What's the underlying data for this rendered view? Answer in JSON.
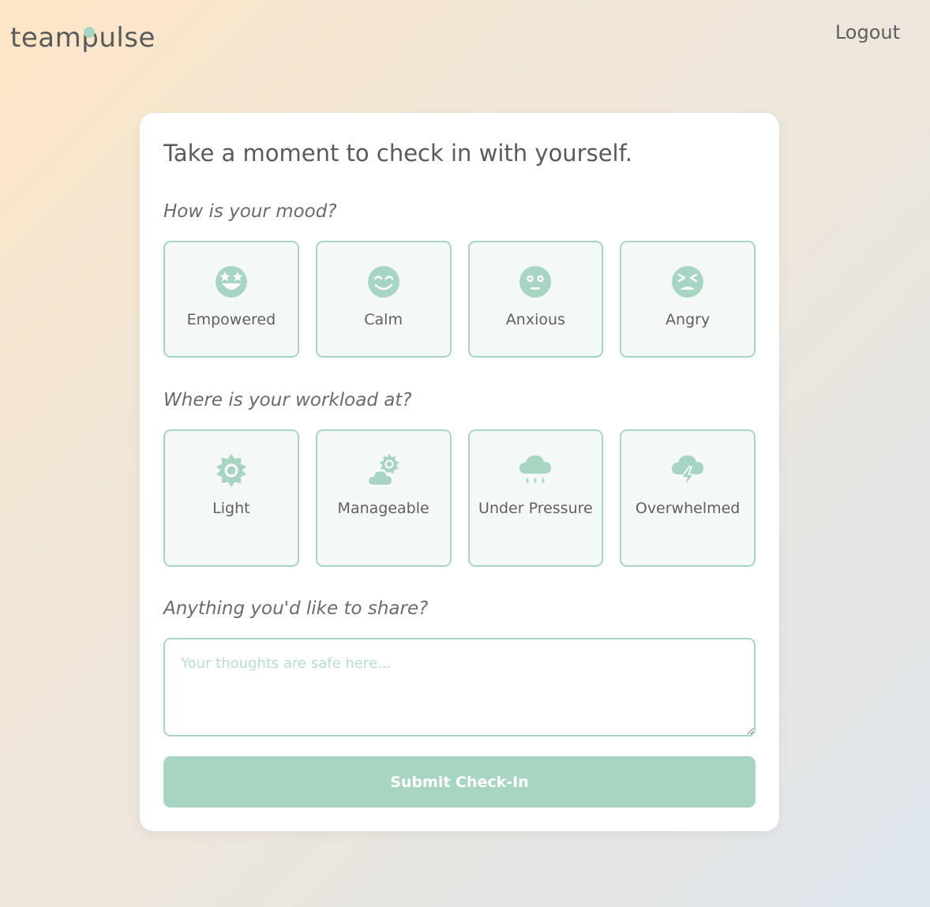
{
  "header": {
    "logo_text_a": "team",
    "logo_text_p": "p",
    "logo_text_b": "ulse",
    "logout_label": "Logout"
  },
  "card": {
    "title": "Take a moment to check in with yourself.",
    "mood": {
      "question": "How is your mood?",
      "options": [
        {
          "label": "Empowered",
          "icon": "star-struck-face-icon"
        },
        {
          "label": "Calm",
          "icon": "smiling-face-icon"
        },
        {
          "label": "Anxious",
          "icon": "anxious-face-icon"
        },
        {
          "label": "Angry",
          "icon": "angry-face-icon"
        }
      ]
    },
    "workload": {
      "question": "Where is your workload at?",
      "options": [
        {
          "label": "Light",
          "icon": "sun-icon"
        },
        {
          "label": "Manageable",
          "icon": "sun-behind-cloud-icon"
        },
        {
          "label": "Under Pressure",
          "icon": "rain-cloud-icon"
        },
        {
          "label": "Overwhelmed",
          "icon": "storm-cloud-icon"
        }
      ]
    },
    "share": {
      "question": "Anything you'd like to share?",
      "placeholder": "Your thoughts are safe here...",
      "value": ""
    },
    "submit_label": "Submit Check-In"
  },
  "colors": {
    "accent": "#a8d5c2",
    "option_bg": "#f4f9f7",
    "text": "#5f5f5f"
  }
}
